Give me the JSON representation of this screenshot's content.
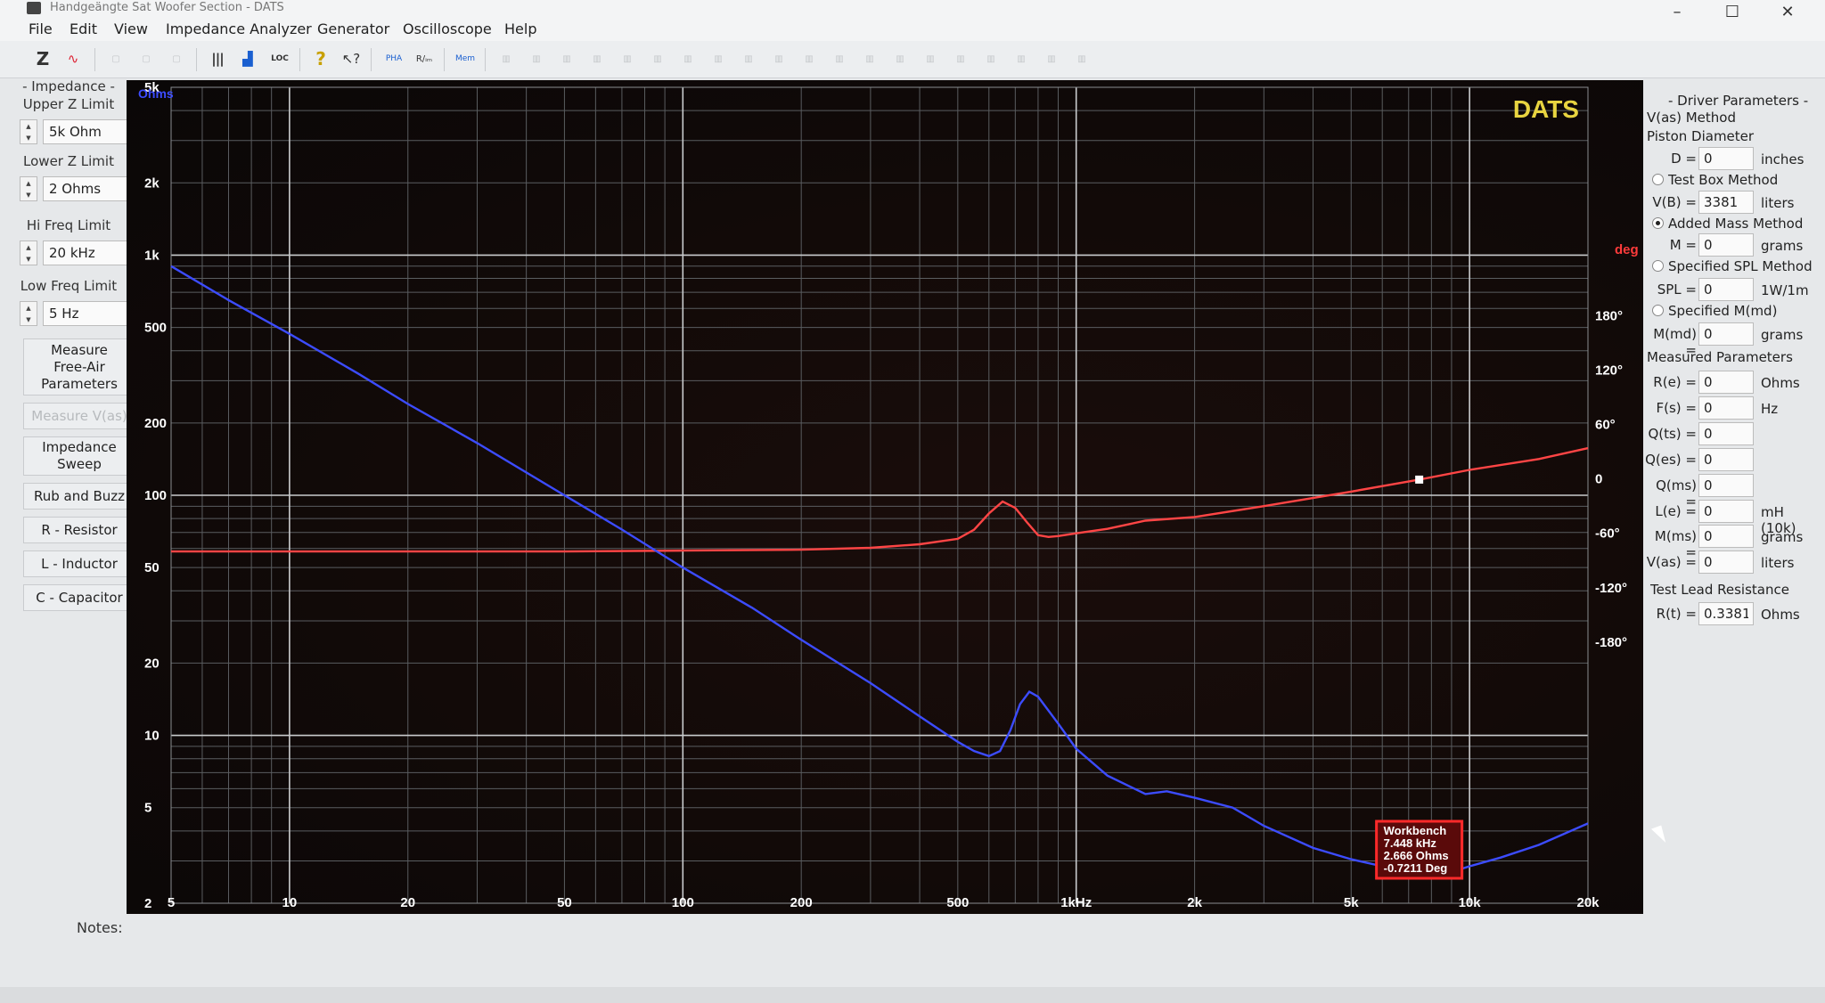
{
  "window": {
    "title": "Handgeängte Sat Woofer Section - DATS"
  },
  "menu": [
    "File",
    "Edit",
    "View",
    "Impedance Analyzer",
    "Generator",
    "Oscilloscope",
    "Help"
  ],
  "toolbar": {
    "z_label": "Z",
    "pha": "PHA",
    "mem": "Mem",
    "loc": "LOC"
  },
  "left": {
    "impedance_title": "- Impedance -",
    "upper_z_label": "Upper Z Limit",
    "upper_z_value": "5k Ohm",
    "lower_z_label": "Lower Z Limit",
    "lower_z_value": "2 Ohms",
    "hi_freq_label": "Hi Freq Limit",
    "hi_freq_value": "20 kHz",
    "low_freq_label": "Low Freq Limit",
    "low_freq_value": "5 Hz",
    "buttons": [
      "Measure\nFree-Air\nParameters",
      "Measure V(as)",
      "Impedance\nSweep",
      "Rub and Buzz",
      "R - Resistor",
      "L - Inductor",
      "C - Capacitor"
    ]
  },
  "right": {
    "driver_title": "- Driver Parameters -",
    "vas_method": "V(as) Method",
    "piston_diameter": "Piston Diameter",
    "d_label": "D =",
    "d_value": "0",
    "d_unit": "inches",
    "test_box": "Test Box Method",
    "vb_label": "V(B) =",
    "vb_value": "3381",
    "vb_unit": "liters",
    "added_mass": "Added Mass Method",
    "m_label": "M =",
    "m_value": "0",
    "m_unit": "grams",
    "spl_method": "Specified SPL Method",
    "spl_label": "SPL =",
    "spl_value": "0",
    "spl_unit": "1W/1m",
    "mmd_method": "Specified M(md)",
    "mmd_label": "M(md) =",
    "mmd_value": "0",
    "mmd_unit": "grams",
    "measured_title": "Measured Parameters",
    "measured": [
      {
        "label": "R(e) =",
        "value": "0",
        "unit": "Ohms"
      },
      {
        "label": "F(s) =",
        "value": "0",
        "unit": "Hz"
      },
      {
        "label": "Q(ts) =",
        "value": "0",
        "unit": ""
      },
      {
        "label": "Q(es) =",
        "value": "0",
        "unit": ""
      },
      {
        "label": "Q(ms) =",
        "value": "0",
        "unit": ""
      },
      {
        "label": "L(e) =",
        "value": "0",
        "unit": "mH (10k)"
      },
      {
        "label": "M(ms) =",
        "value": "0",
        "unit": "grams"
      },
      {
        "label": "V(as) =",
        "value": "0",
        "unit": "liters"
      }
    ],
    "lead_title": "Test Lead Resistance",
    "rt_label": "R(t) =",
    "rt_value": "0.3381",
    "rt_unit": "Ohms"
  },
  "plot": {
    "brand": "DATS",
    "ohms_label": "Ohms",
    "deg_label": "deg",
    "colors": {
      "impedance": "#3c4cff",
      "phase": "#ff4545",
      "brand": "#e8d440",
      "marker": "#ff2a2a"
    },
    "x_ticks": [
      "5",
      "10",
      "20",
      "50",
      "100",
      "200",
      "500",
      "1kHz",
      "2k",
      "5k",
      "10k",
      "20k"
    ],
    "x_tick_values": [
      5,
      10,
      20,
      50,
      100,
      200,
      500,
      1000,
      2000,
      5000,
      10000,
      20000
    ],
    "y_ticks": [
      "5k",
      "2k",
      "1k",
      "500",
      "200",
      "100",
      "50",
      "20",
      "10",
      "5",
      "2"
    ],
    "y_tick_values": [
      5000,
      2000,
      1000,
      500,
      200,
      100,
      50,
      20,
      10,
      5,
      2
    ],
    "phase_ticks": [
      "180°",
      "120°",
      "60°",
      "0",
      "-60°",
      "-120°",
      "-180°"
    ],
    "phase_tick_values": [
      180,
      120,
      60,
      0,
      -60,
      -120,
      -180
    ],
    "marker": {
      "title": "Workbench",
      "freq": "7.448 kHz",
      "ohms": "2.666 Ohms",
      "deg": "-0.7211 Deg"
    }
  },
  "chart_data": {
    "type": "line",
    "x_scale": "log",
    "xlim": [
      5,
      20000
    ],
    "y_scale": "log",
    "ylim": [
      2,
      5000
    ],
    "y2lim": [
      -180,
      180
    ],
    "series": [
      {
        "axis": "left",
        "x": [
          5,
          7,
          10,
          15,
          20,
          30,
          50,
          70,
          100,
          150,
          200,
          300,
          400,
          500,
          550,
          600,
          640,
          680,
          720,
          760,
          800,
          900,
          1000,
          1200,
          1500,
          1700,
          2000,
          2500,
          3000,
          4000,
          5000,
          6000,
          7448,
          9000,
          10000,
          12000,
          15000,
          20000
        ],
        "y": [
          900,
          650,
          470,
          320,
          240,
          165,
          100,
          72,
          50,
          34,
          25,
          16.5,
          12,
          9.4,
          8.6,
          8.2,
          8.6,
          10.5,
          13.5,
          15.2,
          14.5,
          11.2,
          8.8,
          6.8,
          5.7,
          5.85,
          5.5,
          5.0,
          4.2,
          3.4,
          3.05,
          2.85,
          2.666,
          2.7,
          2.85,
          3.1,
          3.5,
          4.3
        ]
      },
      {
        "axis": "right",
        "x": [
          5,
          10,
          20,
          50,
          100,
          200,
          300,
          400,
          500,
          550,
          600,
          650,
          700,
          750,
          800,
          850,
          900,
          1000,
          1200,
          1500,
          2000,
          3000,
          5000,
          7448,
          10000,
          15000,
          20000
        ],
        "y": [
          -80,
          -80,
          -80,
          -80,
          -79,
          -78,
          -76,
          -72,
          -66,
          -56,
          -38,
          -25,
          -32,
          -48,
          -62,
          -64,
          -63,
          -60,
          -55,
          -46,
          -42,
          -30,
          -14,
          -0.72,
          10,
          22,
          34
        ]
      }
    ],
    "marker": {
      "x": 7448,
      "impedance": 2.666,
      "phase": -0.7211
    }
  }
}
